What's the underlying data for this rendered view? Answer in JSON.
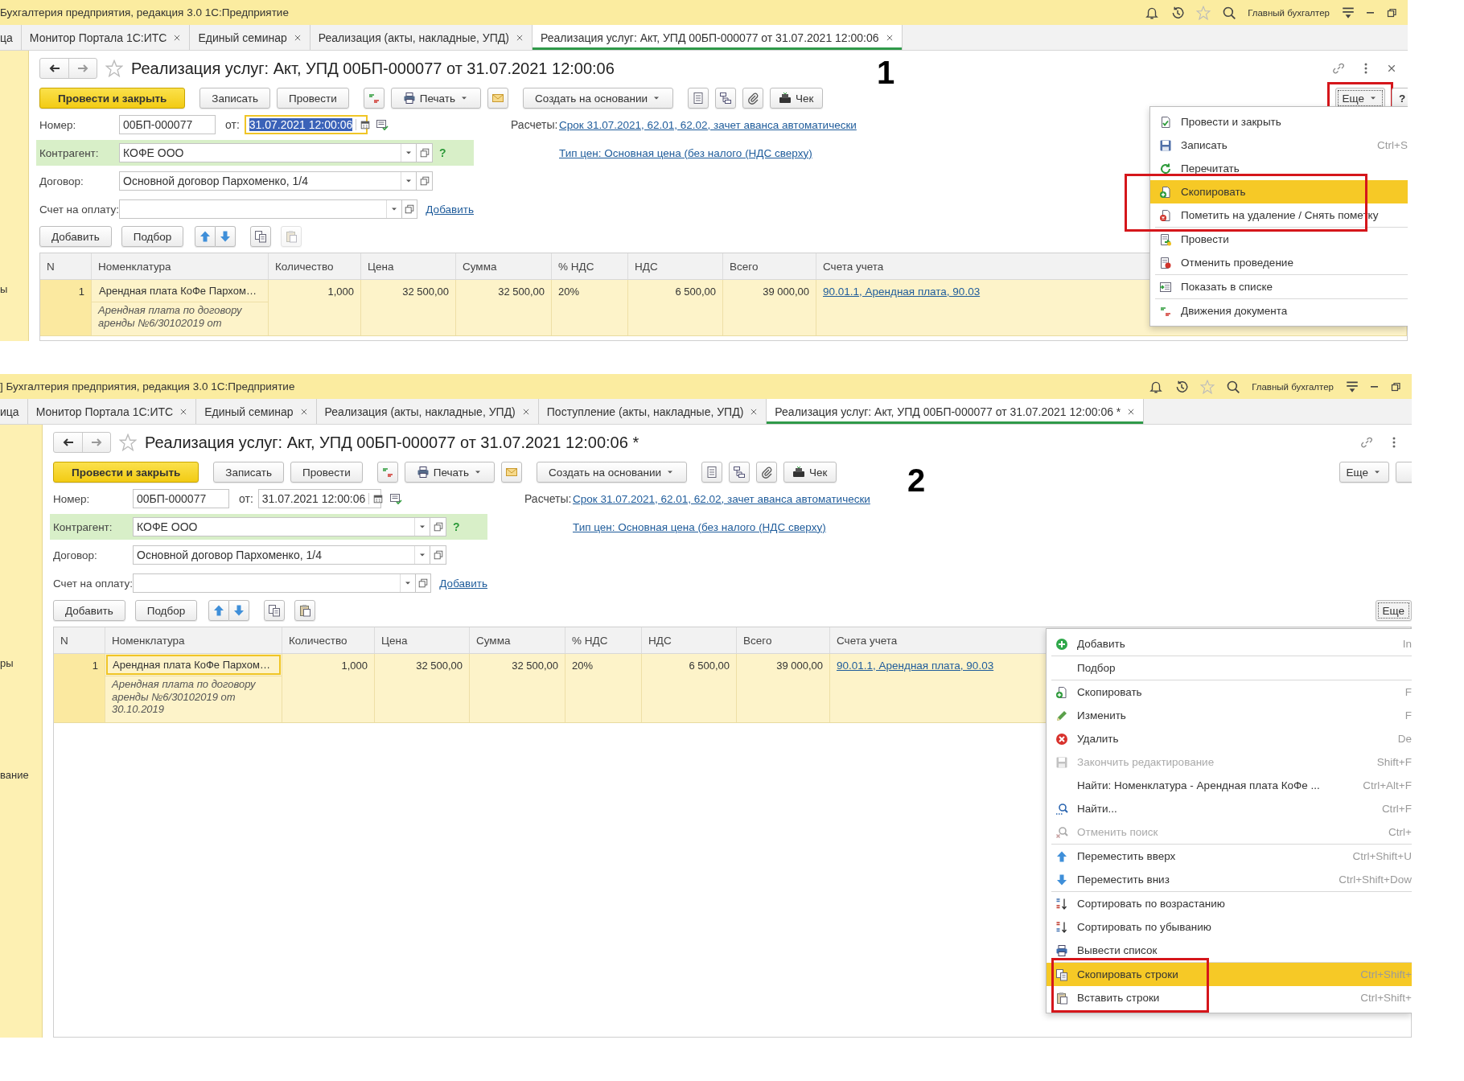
{
  "panels": [
    {
      "caption": "1",
      "app_title": "Бухгалтерия предприятия, редакция 3.0 1С:Предприятие",
      "user": "Главный бухгалтер",
      "tabs": [
        {
          "label": "ца",
          "selected": false,
          "closable": false
        },
        {
          "label": "Монитор Портала 1С:ИТС",
          "selected": false,
          "closable": true
        },
        {
          "label": "Единый семинар",
          "selected": false,
          "closable": true
        },
        {
          "label": "Реализация (акты, накладные, УПД)",
          "selected": false,
          "closable": true
        },
        {
          "label": "Реализация услуг: Акт, УПД 00БП-000077 от 31.07.2021 12:00:06",
          "selected": true,
          "closable": true
        }
      ],
      "sidebar": [
        "ы"
      ],
      "doc_title": "Реализация услуг: Акт, УПД 00БП-000077 от 31.07.2021 12:00:06",
      "closable": true,
      "toolbar": [
        {
          "kind": "primary",
          "label": "Провести и закрыть"
        },
        {
          "kind": "button",
          "label": "Записать"
        },
        {
          "kind": "button",
          "label": "Провести"
        },
        {
          "kind": "icon"
        },
        {
          "kind": "menu",
          "label": "Печать"
        },
        {
          "kind": "icon"
        },
        {
          "kind": "menu",
          "label": "Создать на основании"
        },
        {
          "kind": "icon"
        },
        {
          "kind": "icon"
        },
        {
          "kind": "icon"
        },
        {
          "kind": "button",
          "label": "Чек"
        }
      ],
      "more_button": {
        "label": "Еще",
        "pressed": true,
        "annotated": true
      },
      "help_label": "?",
      "number": {
        "label": "Номер:",
        "value": "00БП-000077"
      },
      "date": {
        "label": "от:",
        "value": "31.07.2021 12:00:06",
        "focused": true
      },
      "settlements": {
        "label": "Расчеты:",
        "link": "Срок 31.07.2021, 62.01, 62.02, зачет аванса автоматически"
      },
      "counterparty": {
        "label": "Контрагент:",
        "value": "КОФЕ ООО",
        "hint": "?"
      },
      "price_type_link": "Тип цен: Основная цена (без налого (НДС сверху)",
      "contract": {
        "label": "Договор:",
        "value": "Основной договор Пархоменко, 1/4"
      },
      "invoice": {
        "label": "Счет на оплату:",
        "link": "Добавить"
      },
      "table_toolbar": [
        {
          "kind": "button",
          "label": "Добавить",
          "disabled": false
        },
        {
          "kind": "button",
          "label": "Подбор",
          "disabled": false
        },
        {
          "kind": "icon",
          "disabled": false
        },
        {
          "kind": "icon",
          "disabled": false
        },
        {
          "kind": "icon",
          "disabled": false
        },
        {
          "kind": "icon",
          "disabled": true
        }
      ],
      "columns": [
        "N",
        "Номенклатура",
        "Количество",
        "Цена",
        "Сумма",
        "% НДС",
        "НДС",
        "Всего",
        "Счета учета"
      ],
      "rows": [
        {
          "n": "1",
          "item": "Арендная плата КоФе Пархом…",
          "item_note": "Арендная плата по договору аренды №6/30102019 от",
          "item_focused": false,
          "quantity": "1,000",
          "price": "32 500,00",
          "sum": "32 500,00",
          "vat_rate": "20%",
          "vat": "6 500,00",
          "total": "39 000,00",
          "account": "90.01.1, Арендная плата, 90.03"
        }
      ],
      "menu": [
        {
          "label": "Провести и закрыть",
          "selected": false
        },
        {
          "label": "Записать",
          "shortcut": "Ctrl+S",
          "selected": false
        },
        {
          "label": "Перечитать",
          "selected": false
        },
        {
          "label": "Скопировать",
          "selected": true,
          "annotated": true
        },
        {
          "label": "Пометить на удаление / Снять пометку",
          "selected": false,
          "annotated": true
        },
        {
          "label": "Провести",
          "selected": false,
          "separator": true
        },
        {
          "label": "Отменить проведение",
          "selected": false
        },
        {
          "label": "Показать в списке",
          "selected": false,
          "separator": true
        },
        {
          "label": "Движения документа",
          "selected": false,
          "separator": true
        }
      ]
    },
    {
      "caption": "2",
      "app_title": "] Бухгалтерия предприятия, редакция 3.0 1С:Предприятие",
      "user": "Главный бухгалтер",
      "tabs": [
        {
          "label": "ица",
          "selected": false,
          "closable": false
        },
        {
          "label": "Монитор Портала 1С:ИТС",
          "selected": false,
          "closable": true
        },
        {
          "label": "Единый семинар",
          "selected": false,
          "closable": true
        },
        {
          "label": "Реализация (акты, накладные, УПД)",
          "selected": false,
          "closable": true
        },
        {
          "label": "Поступление (акты, накладные, УПД)",
          "selected": false,
          "closable": true
        },
        {
          "label": "Реализация услуг: Акт, УПД 00БП-000077 от 31.07.2021 12:00:06 *",
          "selected": true,
          "closable": true
        }
      ],
      "sidebar": [
        "ры",
        "вание"
      ],
      "doc_title": "Реализация услуг: Акт, УПД 00БП-000077 от 31.07.2021 12:00:06 *",
      "closable": false,
      "toolbar": [
        {
          "kind": "primary",
          "label": "Провести и закрыть"
        },
        {
          "kind": "button",
          "label": "Записать"
        },
        {
          "kind": "button",
          "label": "Провести"
        },
        {
          "kind": "icon"
        },
        {
          "kind": "menu",
          "label": "Печать"
        },
        {
          "kind": "icon"
        },
        {
          "kind": "menu",
          "label": "Создать на основании"
        },
        {
          "kind": "icon"
        },
        {
          "kind": "icon"
        },
        {
          "kind": "icon"
        },
        {
          "kind": "button",
          "label": "Чек"
        }
      ],
      "more_button": {
        "label": "Еще",
        "pressed": false,
        "annotated": false
      },
      "number": {
        "label": "Номер:",
        "value": "00БП-000077"
      },
      "date": {
        "label": "от:",
        "value": "31.07.2021 12:00:06",
        "focused": false
      },
      "settlements": {
        "label": "Расчеты:",
        "link": "Срок 31.07.2021, 62.01, 62.02, зачет аванса автоматически"
      },
      "counterparty": {
        "label": "Контрагент:",
        "value": "КОФЕ ООО",
        "hint": "?"
      },
      "price_type_link": "Тип цен: Основная цена (без налого (НДС сверху)",
      "contract": {
        "label": "Договор:",
        "value": "Основной договор Пархоменко, 1/4"
      },
      "invoice": {
        "label": "Счет на оплату:",
        "link": "Добавить"
      },
      "table_toolbar": [
        {
          "kind": "button",
          "label": "Добавить",
          "disabled": false
        },
        {
          "kind": "button",
          "label": "Подбор",
          "disabled": false
        },
        {
          "kind": "icon",
          "disabled": false
        },
        {
          "kind": "icon",
          "disabled": false
        },
        {
          "kind": "icon",
          "disabled": false
        },
        {
          "kind": "icon",
          "disabled": false
        }
      ],
      "table_more_button": {
        "label": "Еще",
        "pressed": true
      },
      "columns": [
        "N",
        "Номенклатура",
        "Количество",
        "Цена",
        "Сумма",
        "% НДС",
        "НДС",
        "Всего",
        "Счета учета"
      ],
      "rows": [
        {
          "n": "1",
          "item": "Арендная плата КоФе Пархом…",
          "item_note": "Арендная плата по договору аренды №6/30102019 от 30.10.2019",
          "item_focused": true,
          "quantity": "1,000",
          "price": "32 500,00",
          "sum": "32 500,00",
          "vat_rate": "20%",
          "vat": "6 500,00",
          "total": "39 000,00",
          "account": "90.01.1, Арендная плата, 90.03"
        }
      ],
      "menu": [
        {
          "label": "Добавить",
          "shortcut": "In",
          "selected": false,
          "disabled": false
        },
        {
          "label": "Подбор",
          "selected": false,
          "disabled": false,
          "separator": true
        },
        {
          "label": "Скопировать",
          "shortcut": "F",
          "selected": false,
          "disabled": false,
          "separator": true
        },
        {
          "label": "Изменить",
          "shortcut": "F",
          "selected": false,
          "disabled": false
        },
        {
          "label": "Удалить",
          "shortcut": "De",
          "selected": false,
          "disabled": false
        },
        {
          "label": "Закончить редактирование",
          "shortcut": "Shift+F",
          "selected": false,
          "disabled": true
        },
        {
          "label": "Найти: Номенклатура - Арендная плата КоФе ...",
          "shortcut": "Ctrl+Alt+F",
          "selected": false,
          "disabled": false
        },
        {
          "label": "Найти...",
          "shortcut": "Ctrl+F",
          "selected": false,
          "disabled": false
        },
        {
          "label": "Отменить поиск",
          "shortcut": "Ctrl+",
          "selected": false,
          "disabled": true
        },
        {
          "label": "Переместить вверх",
          "shortcut": "Ctrl+Shift+U",
          "selected": false,
          "disabled": false,
          "separator": true
        },
        {
          "label": "Переместить вниз",
          "shortcut": "Ctrl+Shift+Dow",
          "selected": false,
          "disabled": false
        },
        {
          "label": "Сортировать по возрастанию",
          "selected": false,
          "disabled": false,
          "separator": true
        },
        {
          "label": "Сортировать по убыванию",
          "selected": false,
          "disabled": false
        },
        {
          "label": "Вывести список",
          "selected": false,
          "disabled": false
        },
        {
          "label": "Скопировать строки",
          "shortcut": "Ctrl+Shift+",
          "selected": true,
          "disabled": false,
          "separator": true,
          "annotated": true
        },
        {
          "label": "Вставить строки",
          "shortcut": "Ctrl+Shift+",
          "selected": false,
          "disabled": false,
          "annotated": true
        }
      ]
    }
  ]
}
